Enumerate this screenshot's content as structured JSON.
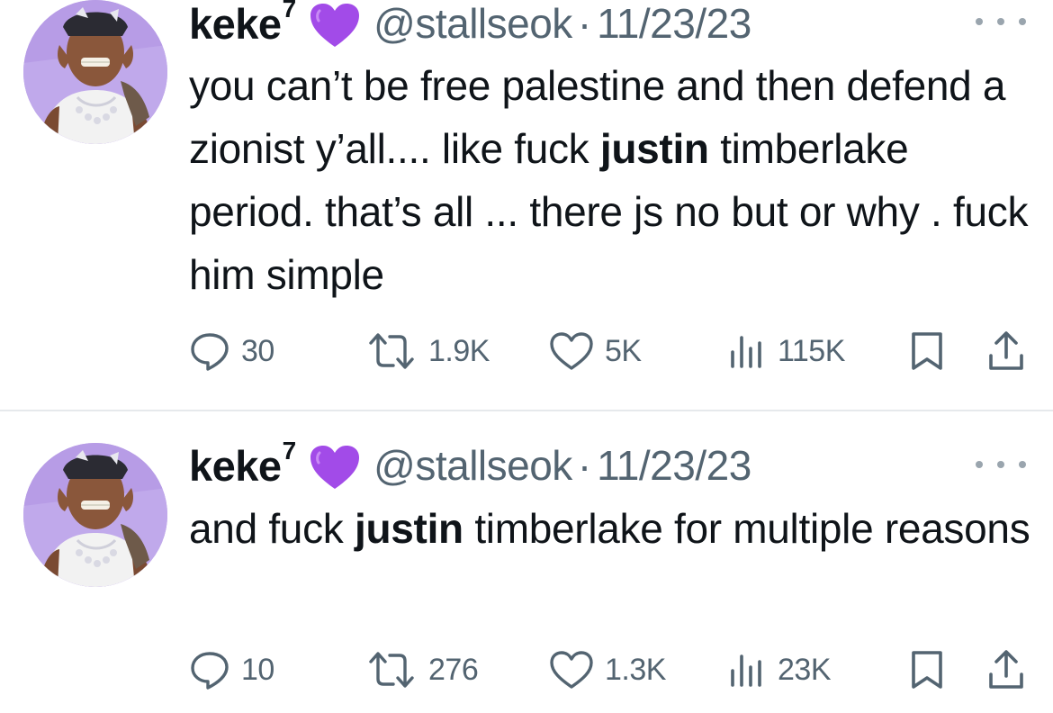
{
  "tweets": [
    {
      "author": {
        "name": "keke",
        "name_superscript": "7",
        "badge": "purple-heart-icon",
        "handle": "@stallseok"
      },
      "separator": "·",
      "date": "11/23/23",
      "text_parts": [
        "you can’t be free palestine and then defend a zionist y’all.... like fuck ",
        "justin",
        " timberlake period. that’s all ... there js no but or why . fuck him simple"
      ],
      "stats": {
        "replies": "30",
        "reposts": "1.9K",
        "likes": "5K",
        "views": "115K"
      }
    },
    {
      "author": {
        "name": "keke",
        "name_superscript": "7",
        "badge": "purple-heart-icon",
        "handle": "@stallseok"
      },
      "separator": "·",
      "date": "11/23/23",
      "text_parts": [
        "and fuck ",
        "justin",
        " timberlake for multiple reasons"
      ],
      "stats": {
        "replies": "10",
        "reposts": "276",
        "likes": "1.3K",
        "views": "23K"
      }
    }
  ],
  "colors": {
    "text_primary": "#0f1419",
    "text_secondary": "#536471",
    "heart_purple": "#a24be8",
    "divider": "#e6e9ec",
    "avatar_background": "#b79ce6"
  }
}
